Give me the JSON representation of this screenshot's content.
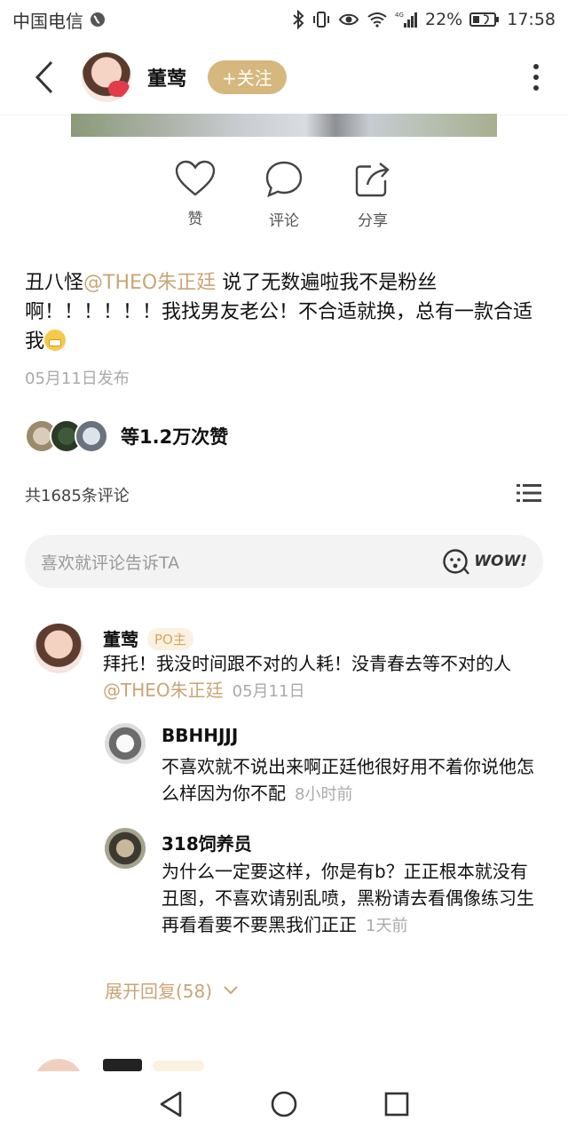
{
  "status": {
    "carrier": "中国电信",
    "battery": "22%",
    "time": "17:58",
    "network": "4G"
  },
  "nav": {
    "user_name": "董莺",
    "follow_label": "+关注"
  },
  "actions": {
    "like": "赞",
    "comment": "评论",
    "share": "分享"
  },
  "post": {
    "prefix": "丑八怪",
    "mention": "@THEO朱正廷",
    "body": "  说了无数遍啦我不是粉丝啊！！！！！！我找男友老公！不合适就换，总有一款合适我",
    "emoji": "grinning-emoji",
    "date": "05月11日发布"
  },
  "likes": {
    "text": "等1.2万次赞"
  },
  "comments_header": {
    "count": "共1685条评论"
  },
  "comment_input": {
    "placeholder": "喜欢就评论告诉TA",
    "wow_label": "WOW!"
  },
  "comments": [
    {
      "name": "董莺",
      "badge": "PO主",
      "text": "拜托！我没时间跟不对的人耗！没青春去等不对的人",
      "mention": "@THEO朱正廷",
      "time": "05月11日"
    }
  ],
  "replies": [
    {
      "name": "BBHHJJJ",
      "text": "不喜欢就不说出来啊正廷他很好用不着你说他怎么样因为你不配",
      "time": "8小时前"
    },
    {
      "name": "318饲养员",
      "text": "为什么一定要这样，你是有b？正正根本就没有丑图，不喜欢请别乱喷，黑粉请去看偶像练习生再看看要不要黑我们正正",
      "time": "1天前"
    }
  ],
  "expand": {
    "label": "展开回复(58)"
  },
  "colors": {
    "accent": "#d6b77e",
    "mention": "#c9a574",
    "badge_bg": "#fbf1e0"
  }
}
